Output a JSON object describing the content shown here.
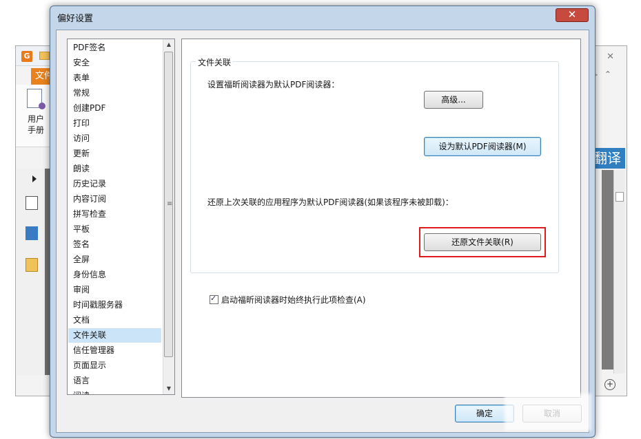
{
  "background_app": {
    "file_tab": "文件",
    "user_manual_label": "用户\n手册",
    "translate_label": "翻译"
  },
  "dialog": {
    "title": "偏好设置",
    "close_glyph": "✕"
  },
  "categories": [
    "PDF签名",
    "安全",
    "表单",
    "常规",
    "创建PDF",
    "打印",
    "访问",
    "更新",
    "朗读",
    "历史记录",
    "内容订阅",
    "拼写检查",
    "平板",
    "签名",
    "全屏",
    "身份信息",
    "审阅",
    "时间戳服务器",
    "文档",
    "文件关联",
    "信任管理器",
    "页面显示",
    "语言",
    "阅读"
  ],
  "selected_category": "文件关联",
  "pane": {
    "group_title": "文件关联",
    "set_default_text": "设置福昕阅读器为默认PDF阅读器：",
    "advanced_button": "高级...",
    "set_default_button": "设为默认PDF阅读器(M)",
    "restore_text": "还原上次关联的应用程序为默认PDF阅读器(如果该程序未被卸载)：",
    "restore_button": "还原文件关联(R)",
    "startup_check_label": "启动福昕阅读器时始终执行此项检查(A)",
    "startup_check_checked": true
  },
  "footer": {
    "ok_button": "确定",
    "cancel_button": "取消"
  },
  "icons": {
    "close": "close-icon",
    "scroll_up": "scroll-up-arrow-icon",
    "scroll_down": "scroll-down-arrow-icon",
    "check": "checkmark-icon"
  },
  "colors": {
    "selection": "#cce4f7",
    "highlight_border": "#e0191f",
    "close_button": "#c74a3f",
    "dialog_frame": "#c3d6ea"
  }
}
